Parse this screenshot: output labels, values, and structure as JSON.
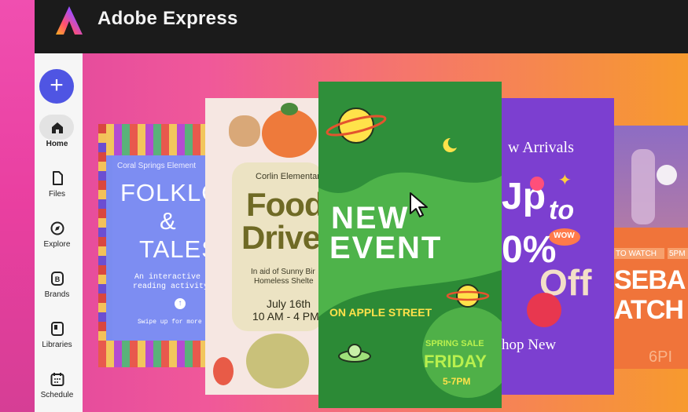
{
  "app": {
    "title": "Adobe Express",
    "logo": "adobe-express-logo"
  },
  "sidebar": {
    "create_label": "+",
    "items": [
      {
        "label": "Home",
        "icon": "home-icon",
        "active": true
      },
      {
        "label": "Files",
        "icon": "file-icon"
      },
      {
        "label": "Explore",
        "icon": "compass-icon"
      },
      {
        "label": "Brands",
        "icon": "brand-icon"
      },
      {
        "label": "Libraries",
        "icon": "library-icon"
      },
      {
        "label": "Schedule",
        "icon": "calendar-icon"
      }
    ]
  },
  "templates": {
    "folklore": {
      "org": "Coral Springs Element",
      "title1": "FOLKLOR",
      "title2": "&",
      "title3": "TALES",
      "sub1": "An interactive",
      "sub2": "reading activity",
      "swipe": "Swipe up for more in"
    },
    "food": {
      "org": "Corlin Elementar",
      "title1": "Food",
      "title2": "Drive",
      "aid1": "In aid of Sunny Bir",
      "aid2": "Homeless Shelte",
      "date": "July 16th",
      "time": "10 AM - 4 PM"
    },
    "event": {
      "title1": "NEW",
      "title2": "EVENT",
      "street": "ON APPLE STREET",
      "sale": "SPRING SALE",
      "day": "FRIDAY",
      "time": "5-7PM"
    },
    "arrivals": {
      "heading": "w Arrivals",
      "up": "Jp",
      "to": "to",
      "wow": "WOW",
      "percent": "0%",
      "off": "Off",
      "shop": "hop New"
    },
    "baseball": {
      "watch": "TO WATCH",
      "tag": "5PM",
      "title1": "SEBA",
      "title2": "ATCH",
      "time": "6PI"
    }
  }
}
